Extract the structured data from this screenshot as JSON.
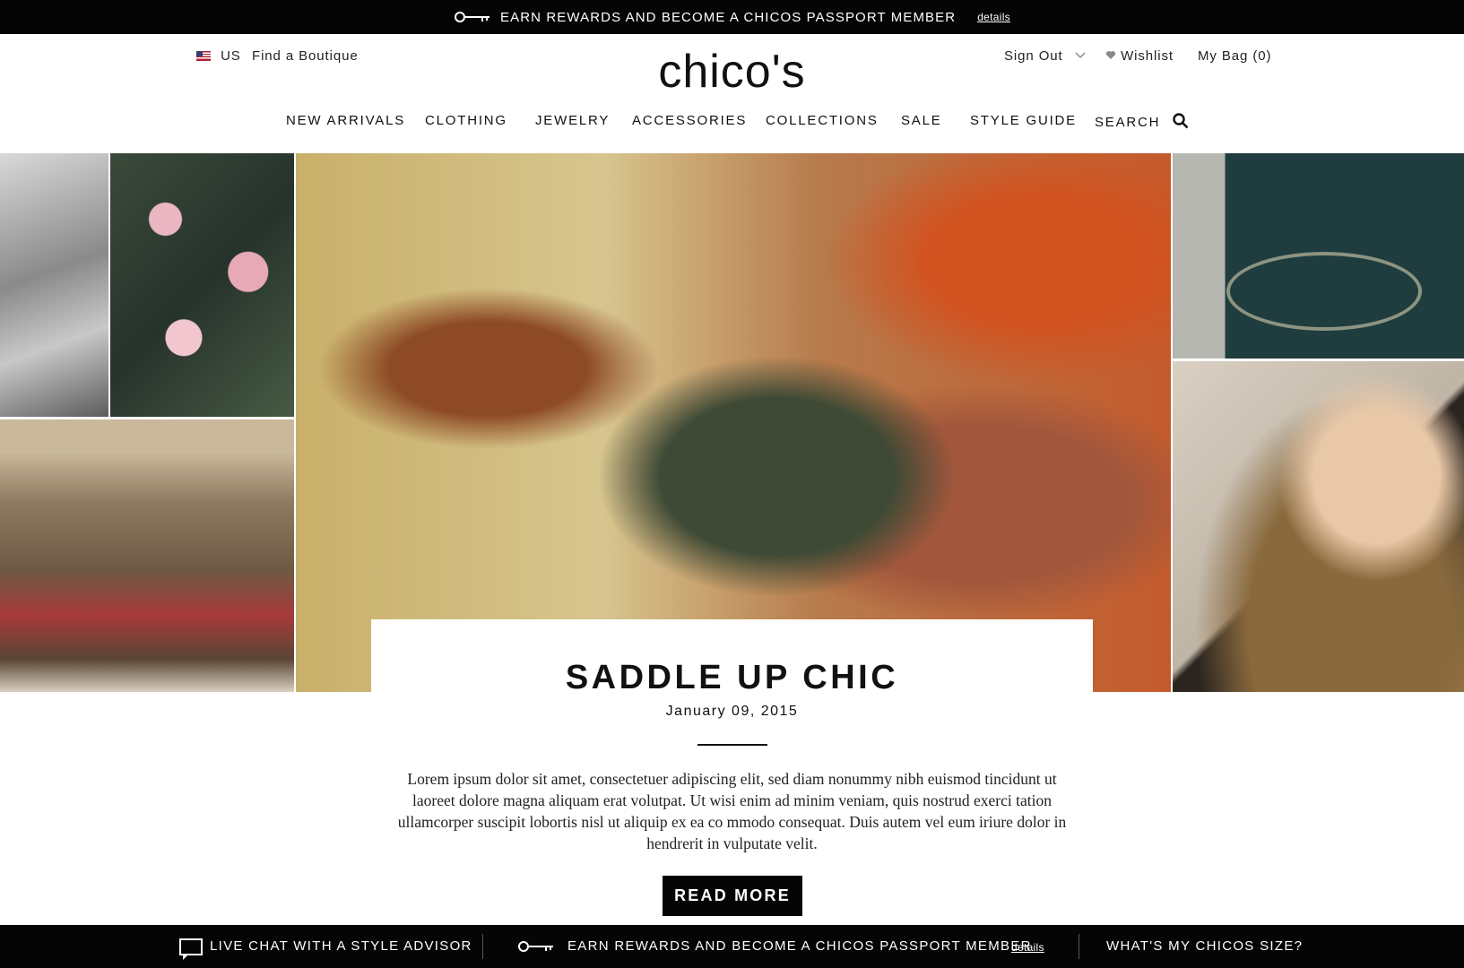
{
  "promo": {
    "text": "EARN REWARDS AND BECOME A CHICOS PASSPORT MEMBER",
    "details": "details"
  },
  "header": {
    "locale": "US",
    "find_boutique": "Find a Boutique",
    "logo": "chico's",
    "sign_out": "Sign Out",
    "wishlist": "Wishlist",
    "bag": "My Bag (0)"
  },
  "nav": {
    "items": [
      "NEW ARRIVALS",
      "CLOTHING",
      "JEWELRY",
      "ACCESSORIES",
      "COLLECTIONS",
      "SALE",
      "STYLE GUIDE",
      "SEARCH"
    ]
  },
  "feature": {
    "title": "SADDLE UP CHIC",
    "date": "January 09, 2015",
    "body": "Lorem ipsum dolor sit amet, consectetuer adipiscing elit, sed diam nonummy nibh euismod tincidunt ut laoreet dolore magna aliquam erat volutpat. Ut wisi enim ad minim veniam, quis nostrud exerci tation ullamcorper suscipit lobortis nisl ut aliquip ex ea co mmodo consequat. Duis autem vel eum iriure dolor in hendrerit in vulputate velit.",
    "cta": "READ MORE"
  },
  "footer_bar": {
    "chat": "LIVE CHAT WITH A STYLE ADVISOR",
    "promo": "EARN REWARDS AND BECOME A CHICOS PASSPORT MEMBER",
    "details": "details",
    "size": "WHAT'S MY CHICOS SIZE?"
  },
  "icons": {
    "key": "key-icon",
    "flag": "us-flag-icon",
    "heart": "heart-icon",
    "chevron": "chevron-down-icon",
    "search": "search-icon",
    "chat": "chat-icon"
  },
  "colors": {
    "bar_bg": "#050505",
    "text": "#111111",
    "page_bg": "#ffffff"
  }
}
